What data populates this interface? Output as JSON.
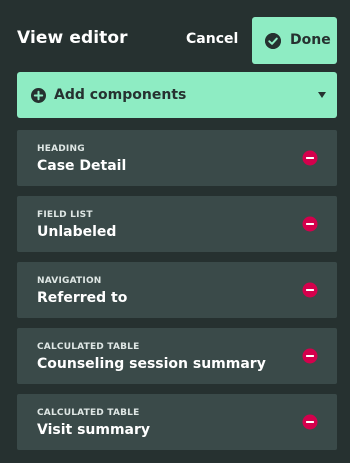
{
  "header": {
    "title": "View editor",
    "cancel_label": "Cancel",
    "done_label": "Done"
  },
  "add_components": {
    "label": "Add components"
  },
  "components": [
    {
      "type": "HEADING",
      "name": "Case Detail"
    },
    {
      "type": "FIELD LIST",
      "name": "Unlabeled"
    },
    {
      "type": "NAVIGATION",
      "name": "Referred to"
    },
    {
      "type": "CALCULATED TABLE",
      "name": "Counseling session summary"
    },
    {
      "type": "CALCULATED TABLE",
      "name": "Visit summary"
    }
  ],
  "colors": {
    "background": "#263130",
    "accent": "#8eecc3",
    "card": "#3a4a49",
    "remove": "#d4004c"
  },
  "icons": {
    "done": "check-circle-icon",
    "add": "plus-circle-icon",
    "dropdown": "caret-down-icon",
    "remove": "minus-circle-icon"
  }
}
